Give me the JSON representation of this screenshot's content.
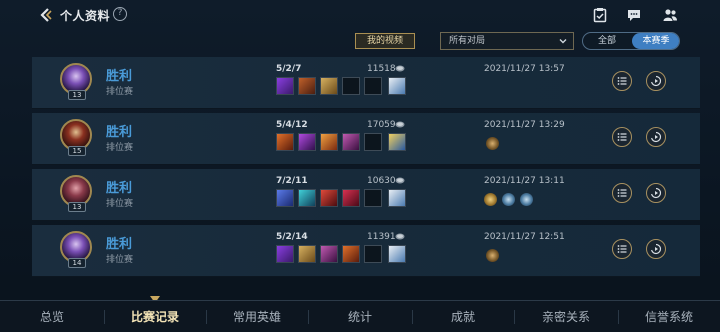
{
  "header": {
    "title": "个人资料",
    "help_glyph": "?"
  },
  "filters": {
    "video_label": "我的视频",
    "match_filter_value": "所有对局",
    "season_all": "全部",
    "season_current": "本赛季"
  },
  "colors": {
    "win": "#4a9bd8",
    "accent_gold": "#a89160",
    "active_toggle": "#3f7fc2"
  },
  "matches": [
    {
      "level": "13",
      "result": "胜利",
      "mode": "排位赛",
      "kda": "5/2/7",
      "score": "11518",
      "datetime": "2021/11/27 13:57",
      "medals": []
    },
    {
      "level": "15",
      "result": "胜利",
      "mode": "排位赛",
      "kda": "5/4/12",
      "score": "17059",
      "datetime": "2021/11/27 13:29",
      "medals": [
        "bronze-medal-icon"
      ]
    },
    {
      "level": "13",
      "result": "胜利",
      "mode": "排位赛",
      "kda": "7/2/11",
      "score": "10630",
      "datetime": "2021/11/27 13:11",
      "medals": [
        "gold-medal-icon",
        "silver-medal-icon",
        "silver-medal-icon"
      ]
    },
    {
      "level": "14",
      "result": "胜利",
      "mode": "排位赛",
      "kda": "5/2/14",
      "score": "11391",
      "datetime": "2021/11/27 12:51",
      "medals": [
        "bronze-medal-icon"
      ]
    }
  ],
  "tabs": [
    {
      "label": "总览"
    },
    {
      "label": "比赛记录"
    },
    {
      "label": "常用英雄"
    },
    {
      "label": "统计"
    },
    {
      "label": "成就"
    },
    {
      "label": "亲密关系"
    },
    {
      "label": "信誉系统"
    }
  ]
}
